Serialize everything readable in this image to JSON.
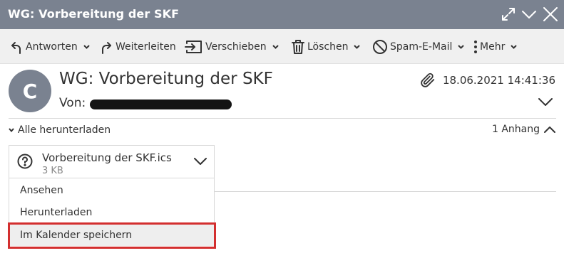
{
  "window": {
    "title": "WG: Vorbereitung der SKF",
    "icons": [
      "expand-icon",
      "collapse-chevron-icon",
      "close-icon"
    ]
  },
  "toolbar": {
    "reply": "Antworten",
    "forward": "Weiterleiten",
    "move": "Verschieben",
    "delete": "Löschen",
    "spam": "Spam-E-Mail",
    "more": "Mehr"
  },
  "message": {
    "avatar_initial": "C",
    "subject": "WG: Vorbereitung der SKF",
    "from_label": "Von:",
    "from_value": "",
    "date": "18.06.2021 14:41:36"
  },
  "attachments": {
    "download_all": "Alle herunterladen",
    "count_label": "1 Anhang",
    "file": {
      "name": "Vorbereitung der SKF.ics",
      "size": "3 KB"
    },
    "menu": [
      {
        "label": "Ansehen"
      },
      {
        "label": "Herunterladen"
      },
      {
        "label": "Im Kalender speichern"
      }
    ]
  },
  "colors": {
    "titlebar": "#7a8290",
    "toolbar": "#f0f0f0",
    "highlight": "#d32f2f"
  }
}
